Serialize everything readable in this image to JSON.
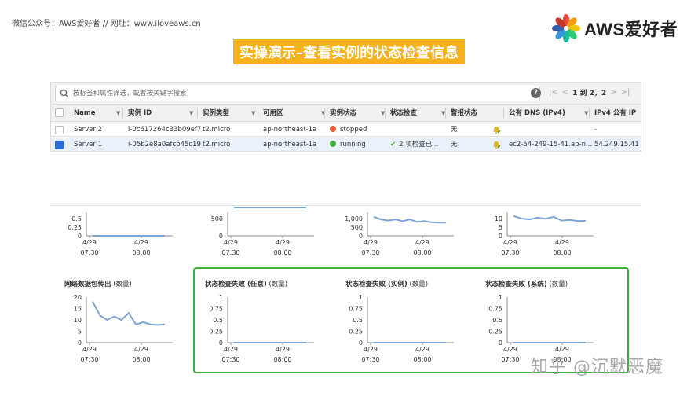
{
  "header": {
    "top_note": "微信公众号：AWS爱好者  //  网址：www.iloveaws.cn",
    "logo_text": "AWS爱好者",
    "title": "实操演示–查看实例的状态检查信息"
  },
  "search": {
    "placeholder": "按标签和属性筛选，或者按关键字搜索",
    "help": "?",
    "pager": {
      "first": "|<",
      "prev": "<",
      "text": "1 到 2，2",
      "next": ">",
      "last": ">|"
    }
  },
  "table": {
    "columns": [
      "Name",
      "实例 ID",
      "实例类型",
      "可用区",
      "实例状态",
      "状态检查",
      "警报状态",
      "公有 DNS (IPv4)",
      "IPv4 公有 IP"
    ],
    "rows": [
      {
        "selected": false,
        "name": "Server 2",
        "id": "i-0c617264c33b09ef7",
        "type": "t2.micro",
        "az": "ap-northeast-1a",
        "state": "stopped",
        "state_color": "#e8603c",
        "check": "",
        "alarm": "无",
        "dns": "",
        "ip": "-"
      },
      {
        "selected": true,
        "name": "Server 1",
        "id": "i-05b2e8a0afcb45c19",
        "type": "t2.micro",
        "az": "ap-northeast-1a",
        "state": "running",
        "state_color": "#46b33d",
        "check": "2 项检查已...",
        "alarm": "无",
        "dns": "ec2-54-249-15-41.ap-n...",
        "ip": "54.249.15.41"
      }
    ]
  },
  "chart_data": [
    {
      "type": "line",
      "title": "",
      "ylabel": "",
      "yticks": [
        "0.5",
        "0.25",
        "0"
      ],
      "ylim": [
        0,
        0.5
      ],
      "xticks": [
        [
          "4/29",
          "07:30"
        ],
        [
          "4/29",
          "08:00"
        ]
      ],
      "x": [
        0,
        1,
        2,
        3,
        4,
        5,
        6,
        7,
        8,
        9
      ],
      "values": [
        0,
        0,
        0,
        0,
        0,
        0,
        0,
        0,
        0,
        0
      ]
    },
    {
      "type": "line",
      "title": "",
      "ylabel": "",
      "yticks": [
        "500",
        "0"
      ],
      "ylim": [
        0,
        1000
      ],
      "xticks": [
        [
          "4/29",
          "07:30"
        ],
        [
          "4/29",
          "08:00"
        ]
      ],
      "x": [
        0,
        1,
        2,
        3,
        4,
        5,
        6,
        7,
        8
      ],
      "values": [
        1050,
        1000,
        1080,
        980,
        1100,
        900,
        950,
        890,
        880
      ]
    },
    {
      "type": "line",
      "title": "",
      "ylabel": "",
      "yticks": [
        "1,000",
        "500",
        "0"
      ],
      "ylim": [
        0,
        1000
      ],
      "xticks": [
        [
          "4/29",
          "07:30"
        ],
        [
          "4/29",
          "08:00"
        ]
      ],
      "x": [
        0,
        1,
        2,
        3,
        4,
        5,
        6,
        7,
        8,
        9,
        10
      ],
      "values": [
        1100,
        950,
        880,
        950,
        850,
        950,
        800,
        850,
        780,
        760,
        760
      ]
    },
    {
      "type": "line",
      "title": "",
      "ylabel": "",
      "yticks": [
        "10",
        "5",
        "0"
      ],
      "ylim": [
        0,
        10
      ],
      "xticks": [
        [
          "4/29",
          "07:30"
        ],
        [
          "4/29",
          "08:00"
        ]
      ],
      "x": [
        0,
        1,
        2,
        3,
        4,
        5,
        6,
        7,
        8,
        9
      ],
      "values": [
        11.5,
        10,
        9.5,
        10.5,
        9.8,
        11,
        8.8,
        9.2,
        8.6,
        8.7
      ]
    },
    {
      "type": "line",
      "title": "网络数据包传出",
      "unit": "(数量)",
      "yticks": [
        "20",
        "15",
        "10",
        "5",
        "0"
      ],
      "ylim": [
        0,
        20
      ],
      "xticks": [
        [
          "4/29",
          "07:30"
        ],
        [
          "4/29",
          "08:00"
        ]
      ],
      "x": [
        0,
        1,
        2,
        3,
        4,
        5,
        6,
        7,
        8,
        9,
        10
      ],
      "values": [
        18,
        12,
        10,
        11.5,
        10,
        13,
        8,
        9,
        8,
        7.8,
        8
      ]
    },
    {
      "type": "line",
      "title": "状态检查失败 (任意)",
      "unit": "(数量)",
      "yticks": [
        "1",
        "0.75",
        "0.5",
        "0.25",
        "0"
      ],
      "ylim": [
        0,
        1
      ],
      "xticks": [
        [
          "4/29",
          "07:30"
        ],
        [
          "4/29",
          "08:00"
        ]
      ],
      "x": [
        0,
        1,
        2,
        3,
        4,
        5,
        6,
        7,
        8,
        9
      ],
      "values": [
        0,
        0,
        0,
        0,
        0,
        0,
        0,
        0,
        0,
        0
      ]
    },
    {
      "type": "line",
      "title": "状态检查失败 (实例)",
      "unit": "(数量)",
      "yticks": [
        "1",
        "0.75",
        "0.5",
        "0.25",
        "0"
      ],
      "ylim": [
        0,
        1
      ],
      "xticks": [
        [
          "4/29",
          "07:30"
        ],
        [
          "4/29",
          "08:00"
        ]
      ],
      "x": [
        0,
        1,
        2,
        3,
        4,
        5,
        6,
        7,
        8,
        9
      ],
      "values": [
        0,
        0,
        0,
        0,
        0,
        0,
        0,
        0,
        0,
        0
      ]
    },
    {
      "type": "line",
      "title": "状态检查失败 (系统)",
      "unit": "(数量)",
      "yticks": [
        "1",
        "0.75",
        "0.5",
        "0.25",
        "0"
      ],
      "ylim": [
        0,
        1
      ],
      "xticks": [
        [
          "4/29",
          "07:30"
        ],
        [
          "4/29",
          "08:00"
        ]
      ],
      "x": [
        0,
        1,
        2,
        3,
        4,
        5,
        6,
        7,
        8,
        9
      ],
      "values": [
        0,
        0,
        0,
        0,
        0,
        0,
        0,
        0,
        0,
        0
      ]
    }
  ],
  "colors": {
    "line": "#7ea3d6",
    "axis": "#888888",
    "banner": "#f5b21a",
    "highlight_box": "#3fae3f"
  },
  "watermark": "知乎 @沉默恶魔"
}
